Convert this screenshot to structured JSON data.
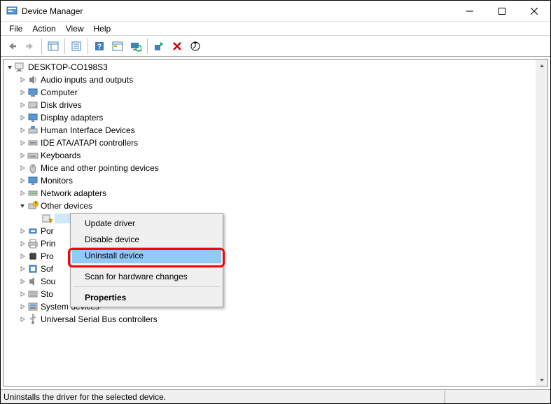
{
  "window": {
    "title": "Device Manager"
  },
  "menu": {
    "file": "File",
    "action": "Action",
    "view": "View",
    "help": "Help"
  },
  "tree": {
    "root": {
      "label": "DESKTOP-CO198S3",
      "expanded": true
    },
    "nodes": [
      {
        "label": "Audio inputs and outputs",
        "icon": "speaker"
      },
      {
        "label": "Computer",
        "icon": "computer"
      },
      {
        "label": "Disk drives",
        "icon": "disk"
      },
      {
        "label": "Display adapters",
        "icon": "display"
      },
      {
        "label": "Human Interface Devices",
        "icon": "hid"
      },
      {
        "label": "IDE ATA/ATAPI controllers",
        "icon": "ide"
      },
      {
        "label": "Keyboards",
        "icon": "keyboard"
      },
      {
        "label": "Mice and other pointing devices",
        "icon": "mouse"
      },
      {
        "label": "Monitors",
        "icon": "monitor"
      },
      {
        "label": "Network adapters",
        "icon": "network"
      },
      {
        "label": "Other devices",
        "icon": "other",
        "expanded": true,
        "selected_child": true
      }
    ],
    "nodes_after": [
      {
        "label": "Por",
        "icon": "port"
      },
      {
        "label": "Prin",
        "icon": "printer"
      },
      {
        "label": "Pro",
        "icon": "processor"
      },
      {
        "label": "Sof",
        "icon": "software"
      },
      {
        "label": "Sou",
        "icon": "sound"
      },
      {
        "label": "Sto",
        "icon": "storage"
      },
      {
        "label": "System devices",
        "icon": "system"
      },
      {
        "label": "Universal Serial Bus controllers",
        "icon": "usb"
      }
    ]
  },
  "context_menu": {
    "items": [
      {
        "label": "Update driver",
        "key": "update"
      },
      {
        "label": "Disable device",
        "key": "disable"
      },
      {
        "label": "Uninstall device",
        "key": "uninstall",
        "highlighted": true
      },
      {
        "sep": true
      },
      {
        "label": "Scan for hardware changes",
        "key": "scan"
      },
      {
        "sep": true
      },
      {
        "label": "Properties",
        "key": "properties",
        "bold": true
      }
    ]
  },
  "status": {
    "text": "Uninstalls the driver for the selected device."
  }
}
